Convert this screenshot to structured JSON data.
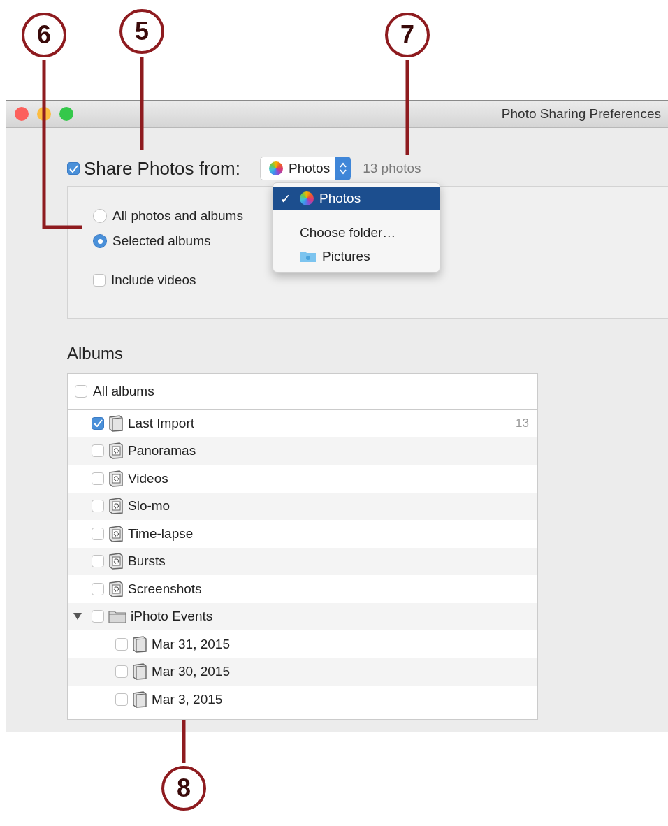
{
  "callouts": [
    {
      "label": "6",
      "kind": "elbow"
    },
    {
      "label": "5",
      "kind": "down"
    },
    {
      "label": "7",
      "kind": "down"
    },
    {
      "label": "8",
      "kind": "up"
    }
  ],
  "window": {
    "title": "Photo Sharing Preferences"
  },
  "share": {
    "checked": true,
    "label": "Share Photos from:",
    "source": "Photos",
    "count": "13 photos"
  },
  "source_menu": [
    {
      "kind": "app",
      "label": "Photos",
      "selected": true,
      "check_mark": "✓"
    },
    {
      "kind": "action",
      "label": "Choose folder…",
      "selected": false
    },
    {
      "kind": "folder",
      "label": "Pictures",
      "selected": false
    }
  ],
  "scope": [
    {
      "label": "All photos and albums",
      "selected": false
    },
    {
      "label": "Selected albums",
      "selected": true
    }
  ],
  "include_videos": {
    "label": "Include videos",
    "checked": false
  },
  "albums": {
    "heading": "Albums",
    "all_albums": {
      "label": "All albums",
      "checked": false
    },
    "items": [
      {
        "kind": "album",
        "label": "Last Import",
        "checked": true,
        "count": "13"
      },
      {
        "kind": "smart",
        "label": "Panoramas",
        "checked": false
      },
      {
        "kind": "smart",
        "label": "Videos",
        "checked": false
      },
      {
        "kind": "smart",
        "label": "Slo-mo",
        "checked": false
      },
      {
        "kind": "smart",
        "label": "Time-lapse",
        "checked": false
      },
      {
        "kind": "smart",
        "label": "Bursts",
        "checked": false
      },
      {
        "kind": "smart",
        "label": "Screenshots",
        "checked": false
      },
      {
        "kind": "folder",
        "label": "iPhoto Events",
        "checked": false,
        "expanded": true,
        "children": [
          {
            "kind": "album",
            "label": "Mar 31, 2015",
            "checked": false
          },
          {
            "kind": "album",
            "label": "Mar 30, 2015",
            "checked": false
          },
          {
            "kind": "album",
            "label": "Mar 3, 2015",
            "checked": false
          }
        ]
      }
    ]
  }
}
